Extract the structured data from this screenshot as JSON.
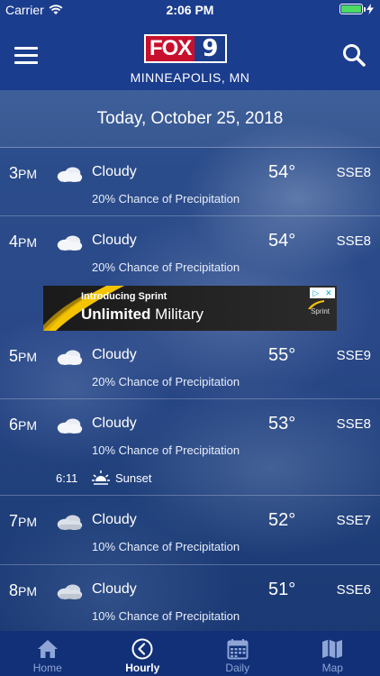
{
  "status_bar": {
    "carrier": "Carrier",
    "time": "2:06 PM"
  },
  "header": {
    "logo_fox": "FOX",
    "logo_num": "9",
    "city": "MINNEAPOLIS, MN"
  },
  "date": "Today, October 25, 2018",
  "hours": [
    {
      "hour": "3",
      "ampm": "PM",
      "icon": "cloudy-icon",
      "condition": "Cloudy",
      "temp": "54°",
      "wind": "SSE8",
      "precip": "20% Chance of Precipitation"
    },
    {
      "hour": "4",
      "ampm": "PM",
      "icon": "cloudy-icon",
      "condition": "Cloudy",
      "temp": "54°",
      "wind": "SSE8",
      "precip": "20% Chance of Precipitation"
    },
    {
      "hour": "5",
      "ampm": "PM",
      "icon": "cloudy-icon",
      "condition": "Cloudy",
      "temp": "55°",
      "wind": "SSE9",
      "precip": "20% Chance of Precipitation"
    },
    {
      "hour": "6",
      "ampm": "PM",
      "icon": "cloudy-icon",
      "condition": "Cloudy",
      "temp": "53°",
      "wind": "SSE8",
      "precip": "10% Chance of Precipitation",
      "sunset_time": "6:11",
      "sunset_label": "Sunset"
    },
    {
      "hour": "7",
      "ampm": "PM",
      "icon": "cloudy-night-icon",
      "condition": "Cloudy",
      "temp": "52°",
      "wind": "SSE7",
      "precip": "10% Chance of Precipitation"
    },
    {
      "hour": "8",
      "ampm": "PM",
      "icon": "cloudy-night-icon",
      "condition": "Cloudy",
      "temp": "51°",
      "wind": "SSE6",
      "precip": "10% Chance of Precipitation"
    }
  ],
  "ad": {
    "line1": "Introducing Sprint",
    "line2_bold": "Unlimited",
    "line2_rest": " Military",
    "brand": "Sprint"
  },
  "tabs": [
    {
      "label": "Home",
      "icon": "home-icon"
    },
    {
      "label": "Hourly",
      "icon": "clock-icon",
      "active": true
    },
    {
      "label": "Daily",
      "icon": "calendar-icon"
    },
    {
      "label": "Map",
      "icon": "map-icon"
    }
  ],
  "colors": {
    "header_bg": "#1b3d8e",
    "tabbar_bg": "#123078",
    "fox_red": "#c8102e",
    "battery_green": "#4cd964"
  }
}
